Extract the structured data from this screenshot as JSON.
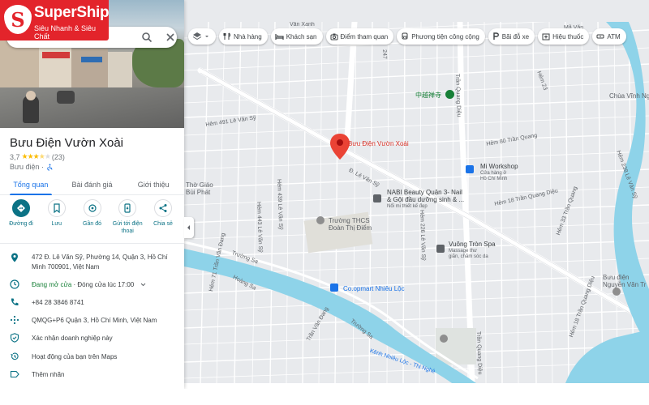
{
  "brand": {
    "letter": "S",
    "name": "SuperShip",
    "slogan": "Siêu Nhanh & Siêu Chất",
    "color": "#e3242b"
  },
  "search": {
    "value": "",
    "search_icon": "search-icon",
    "close_icon": "close-icon"
  },
  "place": {
    "name": "Bưu Điện Vườn Xoài",
    "rating": "3,7",
    "stars_filled": 3.5,
    "reviews": "(23)",
    "category": "Bưu điện ·"
  },
  "tabs": [
    {
      "label": "Tổng quan",
      "active": true
    },
    {
      "label": "Bài đánh giá",
      "active": false
    },
    {
      "label": "Giới thiệu",
      "active": false
    }
  ],
  "actions": [
    {
      "label": "Đường đi",
      "icon": "directions-icon",
      "primary": true
    },
    {
      "label": "Lưu",
      "icon": "bookmark-icon",
      "primary": false
    },
    {
      "label": "Gần đó",
      "icon": "nearby-icon",
      "primary": false
    },
    {
      "label": "Gửi tới điện thoại",
      "icon": "send-to-phone-icon",
      "primary": false
    },
    {
      "label": "Chia sẻ",
      "icon": "share-icon",
      "primary": false
    }
  ],
  "info": {
    "address": "472 Đ. Lê Văn Sỹ, Phường 14, Quận 3, Hồ Chí Minh 700901, Việt Nam",
    "hours_open": "Đang mở cửa",
    "hours_close": " · Đóng cửa lúc 17:00",
    "phone": "+84 28 3846 8741",
    "plus_code": "QMQG+P6 Quận 3, Hồ Chí Minh, Việt Nam",
    "claim": "Xác nhận doanh nghiệp này",
    "activity": "Hoạt động của bạn trên Maps",
    "label": "Thêm nhãn"
  },
  "chips": [
    {
      "label": "Nhà hàng",
      "icon": "restaurant-icon"
    },
    {
      "label": "Khách sạn",
      "icon": "hotel-icon"
    },
    {
      "label": "Điểm tham quan",
      "icon": "camera-icon"
    },
    {
      "label": "Phương tiện công cộng",
      "icon": "transit-icon"
    },
    {
      "label": "Bãi đỗ xe",
      "icon": "parking-icon"
    },
    {
      "label": "Hiệu thuốc",
      "icon": "pharmacy-icon"
    },
    {
      "label": "ATM",
      "icon": "atm-icon"
    }
  ],
  "map": {
    "pin_place": "Bưu Điện Vườn Xoài",
    "water_color": "#8ed3e9",
    "land_color": "#e8eaed",
    "road_color": "#ffffff",
    "pois": {
      "hoa_chinese": "中越禅寺",
      "mi_workshop": "Mi Workshop",
      "mi_workshop_sub1": "Cửa hàng ở",
      "mi_workshop_sub2": "Hồ Chí Minh",
      "nabi_1": "NABI Beauty Quận 3- Nail",
      "nabi_2": "& Gội đầu dưỡng sinh & ...",
      "nabi_3": "Nổi mi thiết kế đẹp",
      "school_1": "Trường THCS",
      "school_2": "Đoàn Thị Điểm",
      "vuong_tron": "Vuông Tròn Spa",
      "vuong_tron_1": "Massage thư",
      "vuong_tron_2": "giãn, chăm sóc da",
      "coopmart": "Co.opmart Nhiêu Lộc",
      "tho_giao": "Thờ Giáo",
      "phat": "Bùi Phát",
      "chua_vinh": "Chùa Vĩnh Ngh",
      "post_right_1": "Bưu điện",
      "post_right_2": "Nguyễn Văn Tr"
    },
    "streets": {
      "le_van_sy": "Đ. Lê Văn Sỹ",
      "hem_491": "Hẻm 491 Lê Văn Sỹ",
      "tran_quang_dieu": "Trần Quang Diệu",
      "hem_80": "Hẻm 80 Trần Quang",
      "hem_18": "Hẻm 18 Trần Quang Diệu",
      "hem_443": "Hẻm 443 Lê Văn Sỹ",
      "truong_sa_1": "Trường Sa",
      "truong_sa_2": "Trường Sa",
      "hoang_sa": "Hoàng Sa",
      "kenh": "Kênh Nhiêu Lộc - Thị Nghè",
      "hem_tran_van_dang": "Hẻm 71 Trần Văn Đang",
      "hem_439": "Hẻm 439 Lê Văn Sỹ",
      "hem_247": "247",
      "hem_226": "Hẻm 226 Lê Văn Sỹ",
      "hem_33": "Hẻm 33 Trần Quang",
      "hem_238": "Hẻm 238 Lê Văn Sỹ",
      "hem_hoang": "Hẻm 18 Trần Quang Diệu",
      "dieu_bottom": "Trần Quang Diệu",
      "van_xanh": "Văn Xanh",
      "tran_van_dang": "Trần Văn Đang",
      "ma_van": "Mã Văn",
      "hem_23": "Hẻm 23"
    }
  }
}
